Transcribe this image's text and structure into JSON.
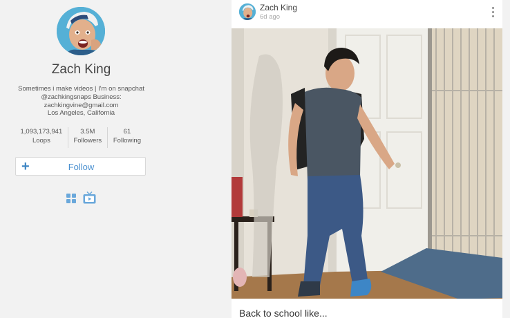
{
  "profile": {
    "name": "Zach King",
    "bio_lines": [
      "Sometimes i make videos | I'm on snapchat",
      "@zachkingsnaps Business:",
      "zachkingvine@gmail.com",
      "Los Angeles, California"
    ],
    "stats": [
      {
        "value": "1,093,173,941",
        "label": "Loops"
      },
      {
        "value": "3.5M",
        "label": "Followers"
      },
      {
        "value": "61",
        "label": "Following"
      }
    ],
    "follow_label": "Follow",
    "icons": {
      "follow": "plus-icon",
      "grid_view": "grid-icon",
      "tv_view": "tv-icon"
    }
  },
  "post": {
    "author": "Zach King",
    "time": "6d ago",
    "caption": "Back to school like...",
    "menu_icon": "kebab-menu-icon"
  },
  "colors": {
    "accent": "#4a90d0",
    "page_background": "#f2f2f2",
    "card_background": "#ffffff"
  }
}
